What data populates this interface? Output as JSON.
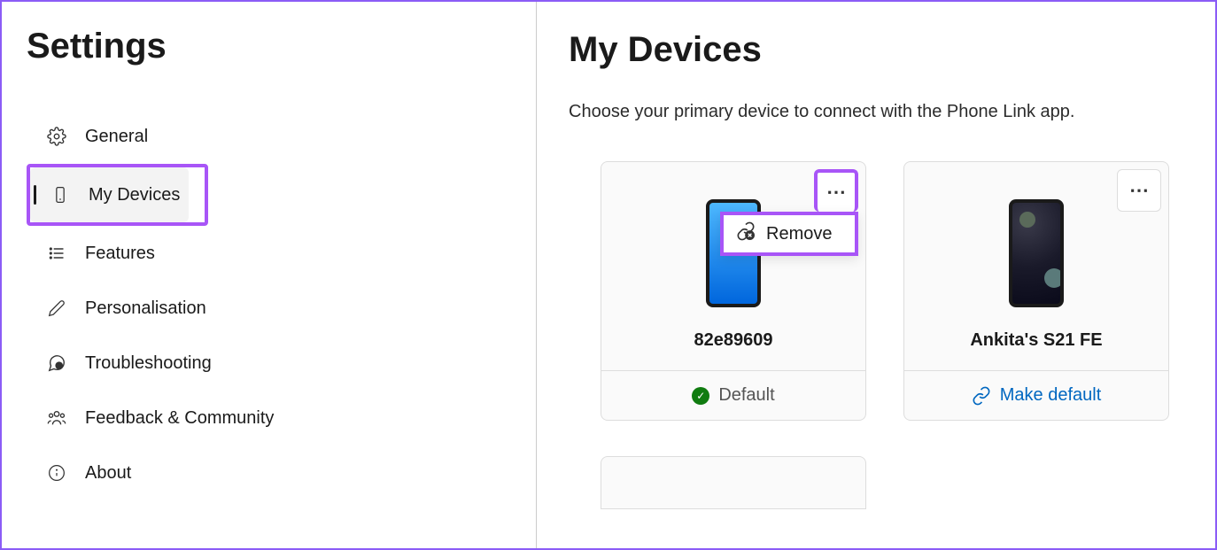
{
  "sidebar": {
    "title": "Settings",
    "items": [
      {
        "label": "General",
        "icon": "gear"
      },
      {
        "label": "My Devices",
        "icon": "phone",
        "selected": true
      },
      {
        "label": "Features",
        "icon": "list"
      },
      {
        "label": "Personalisation",
        "icon": "pen"
      },
      {
        "label": "Troubleshooting",
        "icon": "chat-help"
      },
      {
        "label": "Feedback & Community",
        "icon": "people"
      },
      {
        "label": "About",
        "icon": "info"
      }
    ]
  },
  "main": {
    "title": "My Devices",
    "subtitle": "Choose your primary device to connect with the Phone Link app.",
    "devices": [
      {
        "name": "82e89609",
        "screen": "blue",
        "footer_label": "Default",
        "footer_type": "default",
        "menu_highlighted": true,
        "popup": {
          "label": "Remove"
        }
      },
      {
        "name": "Ankita's S21 FE",
        "screen": "dark",
        "footer_label": "Make default",
        "footer_type": "action"
      }
    ]
  }
}
